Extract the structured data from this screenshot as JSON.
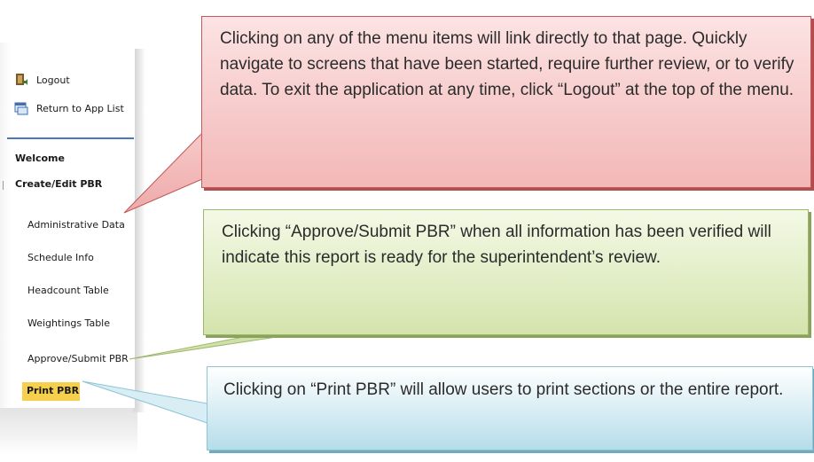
{
  "menu": {
    "logout_label": "Logout",
    "return_label": "Return to App List",
    "welcome_label": "Welcome",
    "create_edit_label": "Create/Edit PBR",
    "items": [
      {
        "label": "Administrative Data"
      },
      {
        "label": "Schedule Info"
      },
      {
        "label": "Headcount Table"
      },
      {
        "label": "Weightings Table"
      },
      {
        "label": "Approve/Submit PBR"
      }
    ],
    "print_label": "Print PBR",
    "highlight_color": "#f6cf4d",
    "divider_color": "#4a78b8",
    "icons": [
      "logout-icon",
      "return-to-app-list-icon"
    ]
  },
  "callouts": {
    "navigation": "Clicking on any of the menu items will link directly to that page. Quickly navigate to screens that have been started, require further review, or to verify data. To exit the application at any time, click “Logout” at the top of the menu.",
    "approve": "Clicking “Approve/Submit PBR” when all information has been verified will indicate this report is ready for the superintendent’s review.",
    "print": "Clicking on “Print PBR” will allow users to print sections or the entire report.",
    "colors": {
      "red": "#f3b7b7",
      "green": "#d4e4ad",
      "blue": "#b5ddea"
    }
  }
}
